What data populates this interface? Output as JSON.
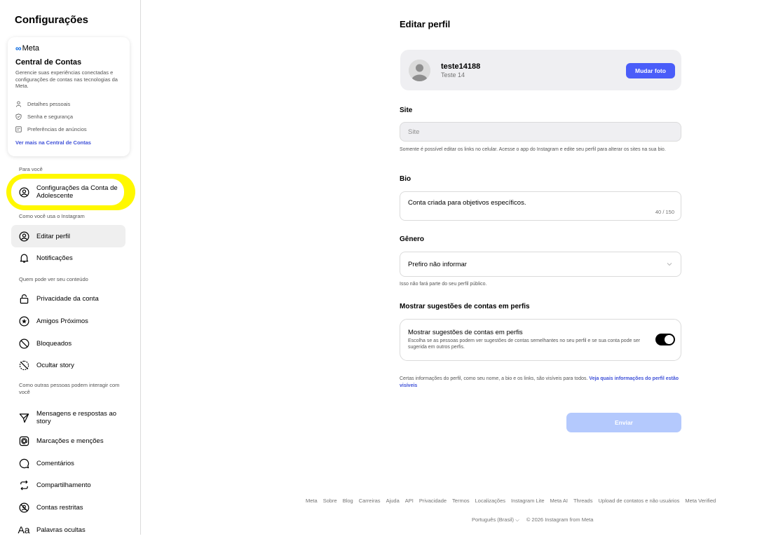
{
  "sidebar": {
    "title": "Configurações",
    "accounts_center": {
      "brand": "Meta",
      "title": "Central de Contas",
      "description": "Gerencie suas experiências conectadas e configurações de contas nas tecnologias da Meta.",
      "items": [
        {
          "label": "Detalhes pessoais",
          "icon": "person-icon"
        },
        {
          "label": "Senha e segurança",
          "icon": "shield-icon"
        },
        {
          "label": "Preferências de anúncios",
          "icon": "ad-icon"
        }
      ],
      "link": "Ver mais na Central de Contas"
    },
    "section_for_you": "Para você",
    "teen_settings": "Configurações da Conta de Adolescente",
    "section_how_you_use": "Como você usa o Instagram",
    "edit_profile": "Editar perfil",
    "notifications": "Notificações",
    "section_who_can_see": "Quem pode ver seu conteúdo",
    "account_privacy": "Privacidade da conta",
    "close_friends": "Amigos Próximos",
    "blocked": "Bloqueados",
    "hide_story": "Ocultar story",
    "section_how_others": "Como outras pessoas podem interagir com você",
    "messages": "Mensagens e respostas ao story",
    "tags": "Marcações e menções",
    "comments": "Comentários",
    "sharing": "Compartilhamento",
    "restricted": "Contas restritas",
    "hidden_words": "Palavras ocultas"
  },
  "main": {
    "title": "Editar perfil",
    "profile": {
      "username": "teste14188",
      "full_name": "Teste 14",
      "change_photo": "Mudar foto"
    },
    "site": {
      "label": "Site",
      "placeholder": "Site",
      "help": "Somente é possível editar os links no celular. Acesse o app do Instagram e edite seu perfil para alterar os sites na sua bio."
    },
    "bio": {
      "label": "Bio",
      "value": "Conta criada para objetivos específicos.",
      "count": "40 / 150"
    },
    "gender": {
      "label": "Gênero",
      "value": "Prefiro não informar",
      "help": "Isso não fará parte do seu perfil público."
    },
    "suggestions": {
      "label": "Mostrar sugestões de contas em perfis",
      "title": "Mostrar sugestões de contas em perfis",
      "description": "Escolha se as pessoas podem ver sugestões de contas semelhantes no seu perfil e se sua conta pode ser sugerida em outros perfis.",
      "enabled": true
    },
    "info": "Certas informações do perfil, como seu nome, a bio e os links, são visíveis para todos.",
    "info_link": "Veja quais informações do perfil estão visíveis",
    "submit": "Enviar"
  },
  "footer": {
    "links": [
      "Meta",
      "Sobre",
      "Blog",
      "Carreiras",
      "Ajuda",
      "API",
      "Privacidade",
      "Termos",
      "Localizações",
      "Instagram Lite",
      "Meta AI",
      "Threads",
      "Upload de contatos e não usuários",
      "Meta Verified"
    ],
    "language": "Português (Brasil)",
    "copyright": "© 2026 Instagram from Meta"
  },
  "colors": {
    "accent": "#4a5df9",
    "highlight": "#fff800",
    "link": "#3f51d8"
  }
}
